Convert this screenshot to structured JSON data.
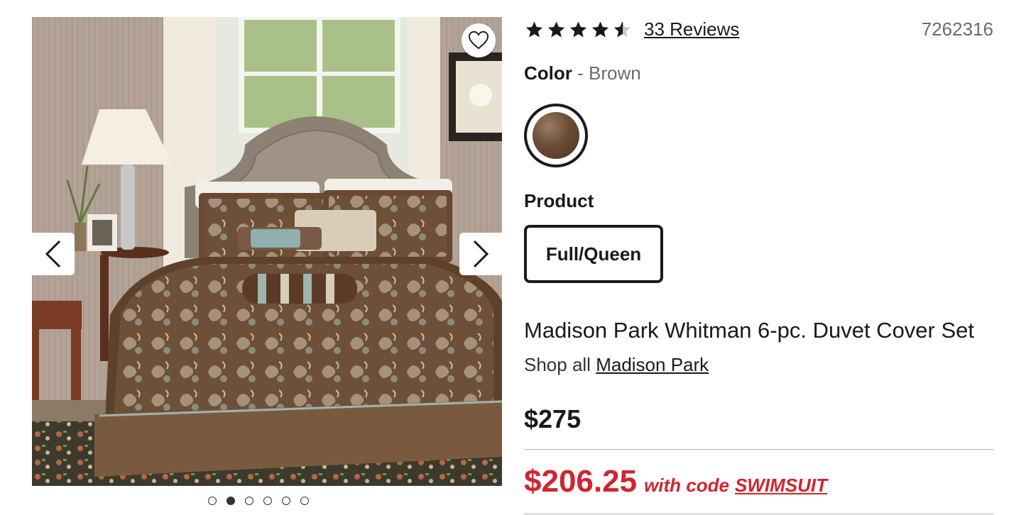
{
  "gallery": {
    "image_alt": "Madison Park Whitman 6-pc. Duvet Cover Set",
    "wishlist_icon": "heart-icon",
    "prev_icon": "chevron-left-icon",
    "next_icon": "chevron-right-icon",
    "slide_count": 6,
    "active_slide": 2
  },
  "rating": {
    "stars": 4.5,
    "reviews_label": "33 Reviews"
  },
  "sku": "7262316",
  "color": {
    "label": "Color",
    "separator": " - ",
    "value": "Brown",
    "swatch_color": "#6b4d38"
  },
  "product_option": {
    "label": "Product",
    "selected": "Full/Queen"
  },
  "title": "Madison Park Whitman 6-pc. Duvet Cover Set",
  "brand": {
    "prefix": "Shop all",
    "name": "Madison Park"
  },
  "pricing": {
    "original": "$275",
    "sale": "$206.25",
    "sale_note": "with code",
    "promo_code": "SWIMSUIT",
    "sale_color": "#d1242f"
  }
}
